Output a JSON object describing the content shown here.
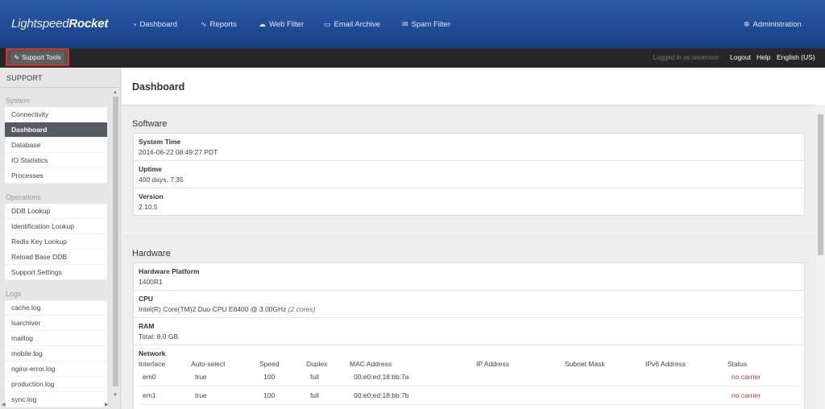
{
  "brand": {
    "logo_light": "Lightspeed",
    "logo_bold": "Rocket"
  },
  "nav": [
    {
      "icon": "dashboard-icon",
      "glyph": "◔",
      "label": "Dashboard"
    },
    {
      "icon": "reports-icon",
      "glyph": "∿",
      "label": "Reports"
    },
    {
      "icon": "web-filter-icon",
      "glyph": "☁",
      "label": "Web Filter"
    },
    {
      "icon": "email-archive-icon",
      "glyph": "▭",
      "label": "Email Archive"
    },
    {
      "icon": "spam-filter-icon",
      "glyph": "✉",
      "label": "Spam Filter"
    },
    {
      "icon": "administration-icon",
      "glyph": "✲",
      "label": "Administration"
    }
  ],
  "subbar": {
    "support_tools": "Support Tools",
    "logged_in": "Logged in as iswanson",
    "logout": "Logout",
    "help": "Help",
    "language": "English (US)"
  },
  "sidebar": {
    "title": "SUPPORT",
    "groups": [
      {
        "label": "System",
        "items": [
          "Connectivity",
          "Dashboard",
          "Database",
          "IO Statistics",
          "Processes"
        ],
        "active": 1
      },
      {
        "label": "Operations",
        "items": [
          "DDB Lookup",
          "Identification Lookup",
          "Redis Key Lookup",
          "Reload Base DDB",
          "Support Settings"
        ]
      },
      {
        "label": "Logs",
        "items": [
          "cache.log",
          "lsarchiver",
          "maillog",
          "mobile.log",
          "nginx-error.log",
          "production.log",
          "sync.log"
        ]
      }
    ]
  },
  "main": {
    "title": "Dashboard",
    "software": {
      "title": "Software",
      "rows": [
        {
          "key": "System Time",
          "value": "2016-06-22 08:49:27 PDT"
        },
        {
          "key": "Uptime",
          "value": "400 days, 7:35"
        },
        {
          "key": "Version",
          "value": "2.10.5"
        }
      ]
    },
    "hardware": {
      "title": "Hardware",
      "platform": {
        "key": "Hardware Platform",
        "value": "1400R1"
      },
      "cpu": {
        "key": "CPU",
        "value": "Intel(R) Core(TM)2 Duo CPU E8400 @ 3.00GHz",
        "cores": "(2 cores)"
      },
      "ram": {
        "key": "RAM",
        "value": "Total: 8.0 GB"
      },
      "network": {
        "key": "Network",
        "columns": [
          "Interface",
          "Auto-select",
          "Speed",
          "Duplex",
          "MAC Address",
          "IP Address",
          "Subnet Mask",
          "IPv6 Address",
          "Status"
        ],
        "rows": [
          {
            "interface": "em0",
            "auto": "true",
            "speed": "100",
            "duplex": "full",
            "mac": "00:e0:ed:18:bb:7a",
            "ip": "",
            "mask": "",
            "ipv6": "",
            "status": "no carrier"
          },
          {
            "interface": "em1",
            "auto": "true",
            "speed": "100",
            "duplex": "full",
            "mac": "00:e0:ed:18:bb:7b",
            "ip": "",
            "mask": "",
            "ipv6": "",
            "status": "no carrier"
          }
        ]
      }
    }
  },
  "colors": {
    "brand_blue": "#1f4a94",
    "highlight_red": "#d8332b",
    "status_red": "#c0392b",
    "active_item": "#555b63"
  }
}
